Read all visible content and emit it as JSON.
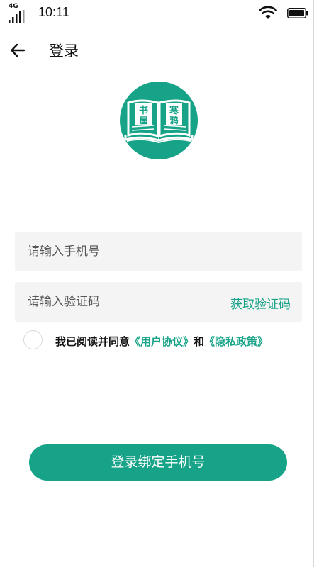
{
  "status_bar": {
    "network": "4G",
    "time": "10:11",
    "signal_icon": "cell-signal-icon",
    "wifi_icon": "wifi-icon",
    "battery_icon": "battery-icon"
  },
  "header": {
    "back_icon": "arrow-left-icon",
    "title": "登录"
  },
  "logo": {
    "characters": [
      "书",
      "屋",
      "寒",
      "鸦"
    ],
    "background_color": "#17a387"
  },
  "form": {
    "phone_placeholder": "请输入手机号",
    "phone_value": "",
    "code_placeholder": "请输入验证码",
    "code_value": "",
    "get_code_label": "获取验证码"
  },
  "agreement": {
    "checked": false,
    "prefix": "我已阅读并同意",
    "user_agreement": "《用户协议》",
    "conjunction": "和",
    "privacy_policy": "《隐私政策》"
  },
  "submit_label": "登录绑定手机号",
  "colors": {
    "accent": "#17a387",
    "input_bg": "#f4f4f4",
    "text": "#111111"
  }
}
